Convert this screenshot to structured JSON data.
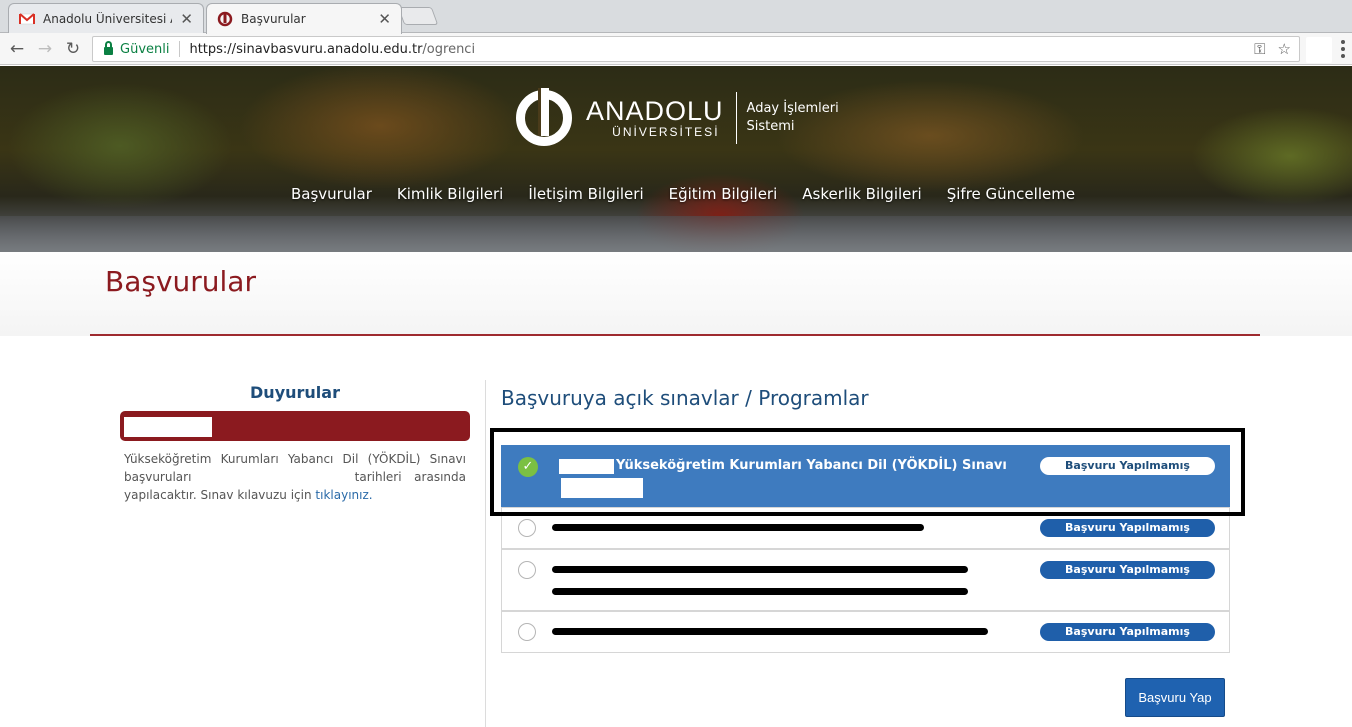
{
  "browser": {
    "tabs": [
      {
        "title": "Anadolu Üniversitesi Ada",
        "favicon": "gmail-icon"
      },
      {
        "title": "Başvurular",
        "favicon": "anadolu-icon"
      }
    ],
    "address": {
      "secure_label": "Güvenli",
      "url_host": "https://sinavbasvuru.anadolu.edu.tr",
      "url_path": "/ogrenci"
    }
  },
  "header": {
    "logo_name": "ANADOLU",
    "logo_sub": "ÜNİVERSİTESİ",
    "system_line1": "Aday İşlemleri",
    "system_line2": "Sistemi",
    "nav": [
      "Başvurular",
      "Kimlik Bilgileri",
      "İletişim Bilgileri",
      "Eğitim Bilgileri",
      "Askerlik Bilgileri",
      "Şifre Güncelleme"
    ]
  },
  "page": {
    "title": "Başvurular"
  },
  "announcements": {
    "title": "Duyurular",
    "text_part1": "Yükseköğretim Kurumları Yabancı Dil (YÖKDİL) Sınavı başvuruları",
    "text_part2": "tarihleri arasında yapılacaktır. Sınav kılavuzu için",
    "link": "tıklayınız."
  },
  "exams": {
    "heading": "Başvuruya açık sınavlar / Programlar",
    "items": [
      {
        "label": "Yükseköğretim Kurumları Yabancı Dil (YÖKDİL) Sınavı",
        "status": "Başvuru Yapılmamış",
        "selected": true
      },
      {
        "label": "",
        "status": "Başvuru Yapılmamış",
        "selected": false
      },
      {
        "label": "",
        "status": "Başvuru Yapılmamış",
        "selected": false
      },
      {
        "label": "",
        "status": "Başvuru Yapılmamış",
        "selected": false
      }
    ],
    "apply_label": "Başvuru Yap"
  },
  "colors": {
    "brand_red": "#8b1a1f",
    "brand_blue": "#1e4d7a",
    "selected_row": "#3e7bbf",
    "pill_dark": "#1f5faa",
    "check_green": "#7bc043"
  }
}
